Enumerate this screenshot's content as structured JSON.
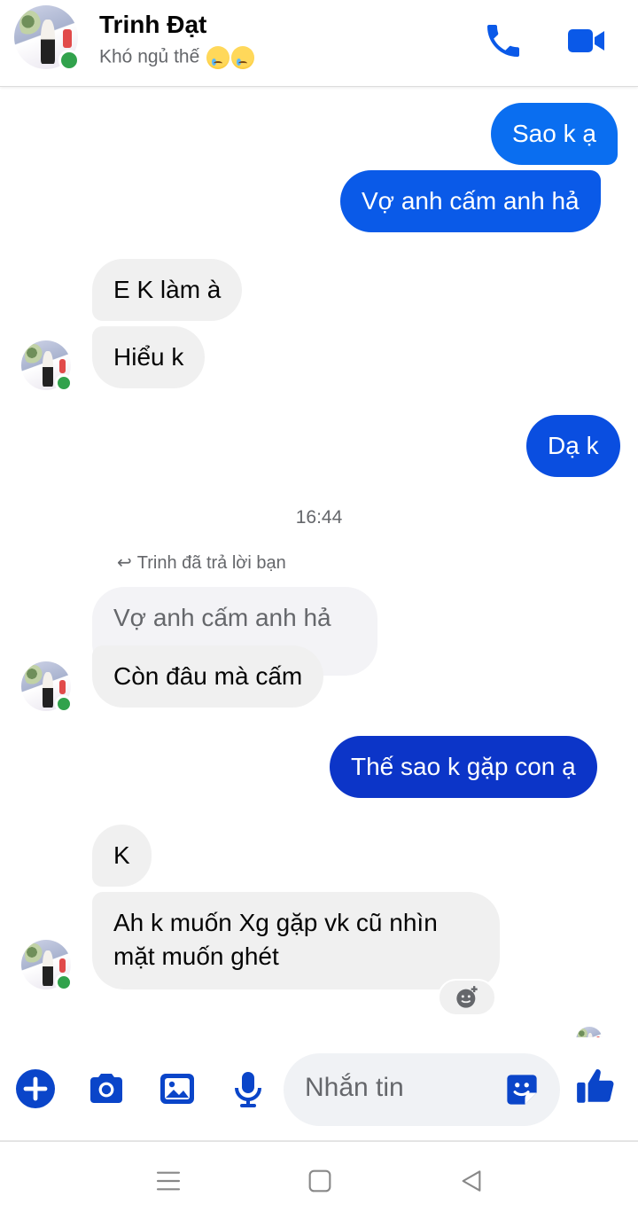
{
  "colors": {
    "brand_blue": "#0a59e8",
    "dark_blue": "#0c33c4",
    "mid_blue": "#0a46d6",
    "icon_blue": "#0a45c9",
    "incoming_bg": "#f0f0f0",
    "online_green": "#31a24c"
  },
  "header": {
    "name": "Trinh Đạt",
    "status_text": "Khó ngủ thế",
    "status_emoji": "crying-face-emoji",
    "call_icon": "phone-icon",
    "video_icon": "video-camera-icon"
  },
  "messages": {
    "out_1": "Sao k ạ",
    "out_2": "Vợ anh cấm anh hả",
    "in_1": "E K làm à",
    "in_2": "Hiểu k",
    "out_3": "Dạ k",
    "timestamp": "16:44",
    "reply_note": "Trinh đã trả lời bạn",
    "quoted": "Vợ anh cấm anh hả",
    "in_3": "Còn đâu mà cấm",
    "out_4": "Thế sao k gặp con ạ",
    "in_4": "K",
    "in_5_line1": "Ah k muốn Xg gặp vk cũ nhìn",
    "in_5_line2": "mặt muốn ghét"
  },
  "composer": {
    "placeholder": "Nhắn tin",
    "icons": [
      "plus-circle-icon",
      "camera-icon",
      "image-icon",
      "microphone-icon",
      "sticker-icon",
      "thumbs-up-icon"
    ]
  },
  "navbar": {
    "icons": [
      "menu-icon",
      "home-square-icon",
      "back-triangle-icon"
    ]
  }
}
